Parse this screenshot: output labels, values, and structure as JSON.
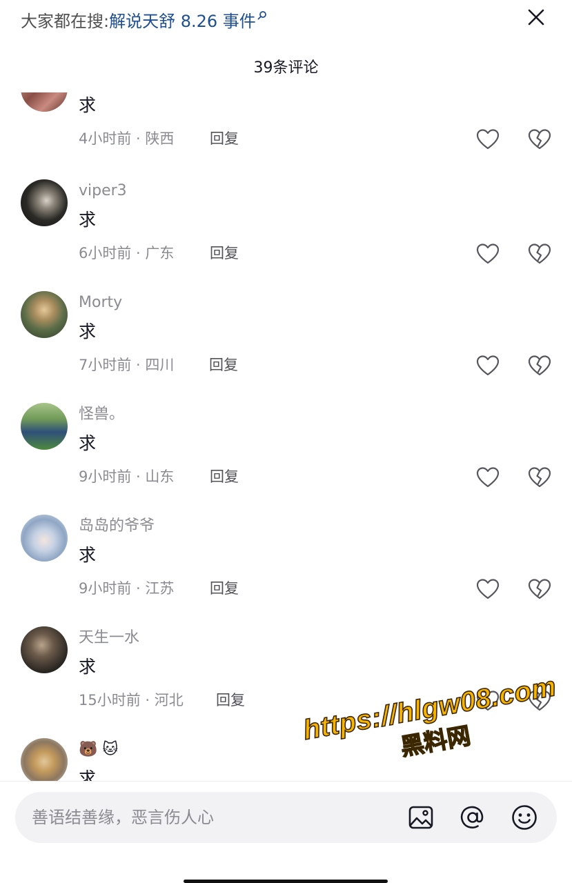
{
  "header": {
    "search_label": "大家都在搜:",
    "search_term": "解说天舒 8.26 事件",
    "comment_count": "39条评论"
  },
  "comments": [
    {
      "username": "",
      "text": "求",
      "time": "4小时前",
      "location": "陕西",
      "meta": "4小时前 · 陕西",
      "reply": "回复"
    },
    {
      "username": "viper3",
      "text": "求",
      "time": "6小时前",
      "location": "广东",
      "meta": "6小时前 · 广东",
      "reply": "回复"
    },
    {
      "username": "Morty",
      "text": "求",
      "time": "7小时前",
      "location": "四川",
      "meta": "7小时前 · 四川",
      "reply": "回复"
    },
    {
      "username": "怪兽。",
      "text": "求",
      "time": "9小时前",
      "location": "山东",
      "meta": "9小时前 · 山东",
      "reply": "回复"
    },
    {
      "username": "岛岛的爷爷",
      "text": "求",
      "time": "9小时前",
      "location": "江苏",
      "meta": "9小时前 · 江苏",
      "reply": "回复"
    },
    {
      "username": "天生一水",
      "text": "求",
      "time": "15小时前",
      "location": "河北",
      "meta": "15小时前 · 河北",
      "reply": "回复"
    },
    {
      "username": "🐻 🐱",
      "text": "求",
      "time": "",
      "location": "",
      "meta": "",
      "reply": ""
    }
  ],
  "watermark": {
    "url": "https://hlgw08.com",
    "site": "黑料网"
  },
  "input": {
    "placeholder": "善语结善缘，恶言伤人心"
  },
  "icons": {
    "close": "close-icon",
    "search": "search-icon",
    "like": "heart-outline-icon",
    "dislike": "broken-heart-icon",
    "image": "image-icon",
    "mention": "at-icon",
    "emoji": "emoji-icon"
  },
  "colors": {
    "search_term": "#1d4f91",
    "secondary_text": "#8a8b91",
    "watermark": "#f6b400"
  }
}
